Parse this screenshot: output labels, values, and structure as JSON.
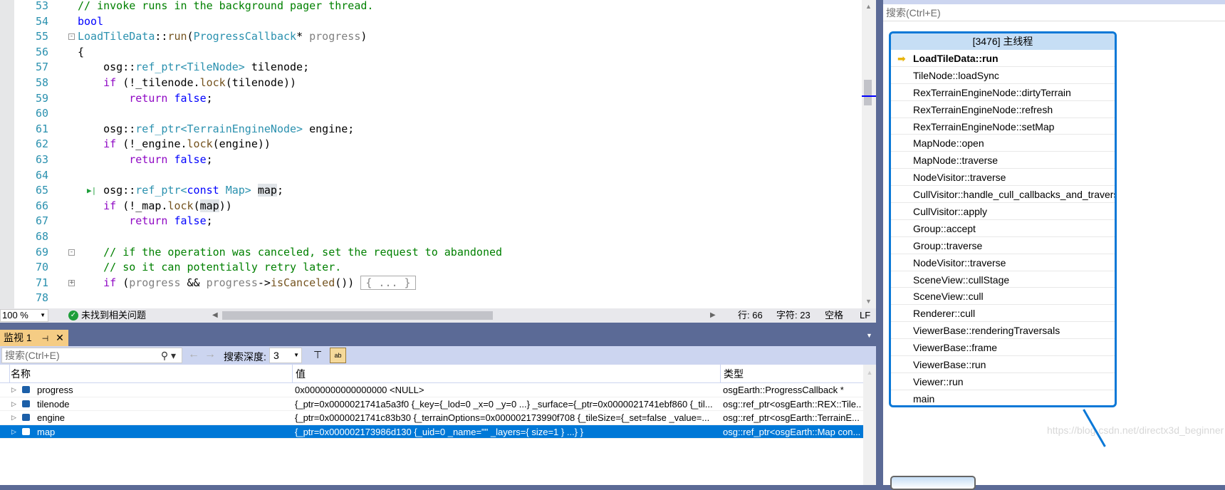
{
  "editor": {
    "lines": [
      {
        "n": "53",
        "tokens": [
          [
            "c",
            "// invoke runs in the background pager thread."
          ]
        ]
      },
      {
        "n": "54",
        "tokens": [
          [
            "k",
            "bool"
          ]
        ]
      },
      {
        "n": "55",
        "fold": "-",
        "tokens": [
          [
            "t",
            "LoadTileData"
          ],
          [
            "",
            "::"
          ],
          [
            "f",
            "run"
          ],
          [
            "",
            "("
          ],
          [
            "t",
            "ProgressCallback"
          ],
          [
            "",
            "* "
          ],
          [
            "p",
            "progress"
          ],
          [
            "",
            ")"
          ]
        ]
      },
      {
        "n": "56",
        "tokens": [
          [
            "",
            "{"
          ]
        ]
      },
      {
        "n": "57",
        "tokens": [
          [
            "",
            "    osg::"
          ],
          [
            "t",
            "ref_ptr"
          ],
          [
            "t",
            "<TileNode>"
          ],
          [
            "",
            " tilenode;"
          ]
        ]
      },
      {
        "n": "58",
        "tokens": [
          [
            "kw",
            "    if"
          ],
          [
            "",
            " (!_tilenode."
          ],
          [
            "f",
            "lock"
          ],
          [
            "",
            "(tilenode))"
          ]
        ]
      },
      {
        "n": "59",
        "tokens": [
          [
            "kw",
            "        return"
          ],
          [
            "k",
            " false"
          ],
          [
            "",
            ";"
          ]
        ]
      },
      {
        "n": "60",
        "tokens": []
      },
      {
        "n": "61",
        "tokens": [
          [
            "",
            "    osg::"
          ],
          [
            "t",
            "ref_ptr"
          ],
          [
            "t",
            "<TerrainEngineNode>"
          ],
          [
            "",
            " engine;"
          ]
        ]
      },
      {
        "n": "62",
        "tokens": [
          [
            "kw",
            "    if"
          ],
          [
            "",
            " (!_engine."
          ],
          [
            "f",
            "lock"
          ],
          [
            "",
            "(engine))"
          ]
        ]
      },
      {
        "n": "63",
        "tokens": [
          [
            "kw",
            "        return"
          ],
          [
            "k",
            " false"
          ],
          [
            "",
            ";"
          ]
        ]
      },
      {
        "n": "64",
        "tokens": []
      },
      {
        "n": "65",
        "tokens": [
          [
            "",
            "    osg::"
          ],
          [
            "t",
            "ref_ptr"
          ],
          [
            "t",
            "<"
          ],
          [
            "k",
            "const"
          ],
          [
            "t",
            " Map>"
          ],
          [
            "",
            " "
          ],
          [
            "hl",
            "map"
          ],
          [
            "",
            ";"
          ]
        ]
      },
      {
        "n": "66",
        "tokens": [
          [
            "kw",
            "    if"
          ],
          [
            "",
            " (!_map."
          ],
          [
            "f",
            "lock"
          ],
          [
            "",
            "("
          ],
          [
            "hl",
            "map"
          ],
          [
            "",
            "))"
          ]
        ]
      },
      {
        "n": "67",
        "tokens": [
          [
            "kw",
            "        return"
          ],
          [
            "k",
            " false"
          ],
          [
            "",
            ";"
          ]
        ]
      },
      {
        "n": "68",
        "tokens": []
      },
      {
        "n": "69",
        "fold": "-",
        "tokens": [
          [
            "c",
            "    // if the operation was canceled, set the request to abandoned"
          ]
        ]
      },
      {
        "n": "70",
        "tokens": [
          [
            "c",
            "    // so it can potentially retry later."
          ]
        ]
      },
      {
        "n": "71",
        "fold": "+",
        "tokens": [
          [
            "kw",
            "    if"
          ],
          [
            "",
            " ("
          ],
          [
            "p",
            "progress"
          ],
          [
            "",
            " && "
          ],
          [
            "p",
            "progress"
          ],
          [
            "",
            "->"
          ],
          [
            "f",
            "isCanceled"
          ],
          [
            "",
            "()) "
          ],
          [
            "collapsed",
            "{ ... }"
          ]
        ]
      },
      {
        "n": "78",
        "tokens": []
      }
    ]
  },
  "status": {
    "zoom": "100 %",
    "issues": "未找到相关问题",
    "line": "行: 66",
    "char": "字符: 23",
    "spaces": "空格",
    "eol": "LF"
  },
  "watch": {
    "tab": "监视 1",
    "search_placeholder": "搜索(Ctrl+E)",
    "depth_label": "搜索深度:",
    "depth_value": "3",
    "columns": [
      "名称",
      "值",
      "类型"
    ],
    "rows": [
      {
        "name": "progress",
        "value": "0x0000000000000000 <NULL>",
        "type": "osgEarth::ProgressCallback *"
      },
      {
        "name": "tilenode",
        "value": "{_ptr=0x0000021741a5a3f0 {_key={_lod=0 _x=0 _y=0 ...} _surface={_ptr=0x0000021741ebf860 {_til...",
        "type": "osg::ref_ptr<osgEarth::REX::Tile..."
      },
      {
        "name": "engine",
        "value": "{_ptr=0x0000021741c83b30 {_terrainOptions=0x000002173990f708 {_tileSize={_set=false _value=...",
        "type": "osg::ref_ptr<osgEarth::TerrainE..."
      },
      {
        "name": "map",
        "value": "{_ptr=0x000002173986d130 {_uid=0 _name=\"\" _layers={ size=1 } ...} }",
        "type": "osg::ref_ptr<osgEarth::Map con...",
        "selected": true
      }
    ]
  },
  "right": {
    "search_placeholder": "搜索(Ctrl+E)",
    "stack_title": "[3476] 主线程",
    "watermark": "https://blog.csdn.net/directx3d_beginner",
    "frames": [
      "LoadTileData::run",
      "TileNode::loadSync",
      "RexTerrainEngineNode::dirtyTerrain",
      "RexTerrainEngineNode::refresh",
      "RexTerrainEngineNode::setMap",
      "MapNode::open",
      "MapNode::traverse",
      "NodeVisitor::traverse",
      "CullVisitor::handle_cull_callbacks_and_traverse",
      "CullVisitor::apply",
      "Group::accept",
      "Group::traverse",
      "NodeVisitor::traverse",
      "SceneView::cullStage",
      "SceneView::cull",
      "Renderer::cull",
      "ViewerBase::renderingTraversals",
      "ViewerBase::frame",
      "ViewerBase::run",
      "Viewer::run",
      "main"
    ]
  },
  "colors": {
    "accent": "#0078d7",
    "chrome": "#5b6a96",
    "tab": "#f5cc84"
  }
}
